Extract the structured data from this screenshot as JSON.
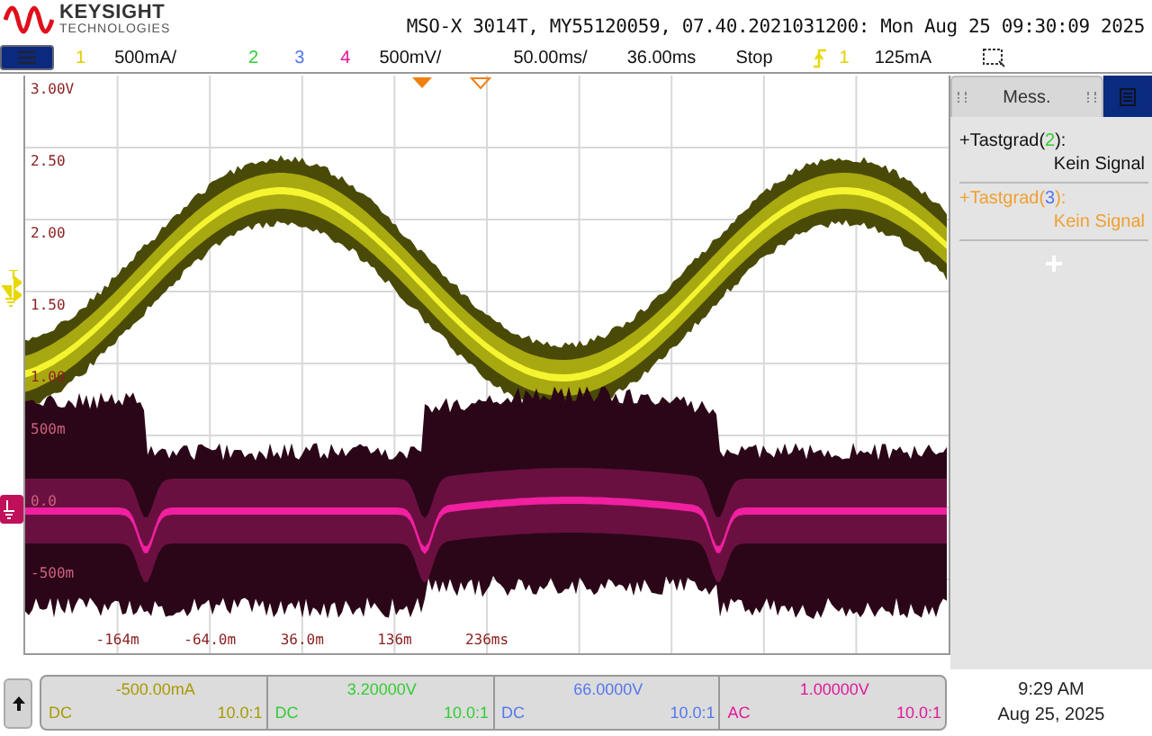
{
  "header": {
    "logo": {
      "name": "KEYSIGHT",
      "sub": "TECHNOLOGIES"
    },
    "title": "MSO-X 3014T, MY55120059, 07.40.2021031200: Mon Aug 25 09:30:09 2025"
  },
  "channel_bar": {
    "channels": [
      {
        "number": "1",
        "color": "#e0d000",
        "scale": "500mA/"
      },
      {
        "number": "2",
        "color": "#33cc33"
      },
      {
        "number": "3",
        "color": "#5577ee"
      },
      {
        "number": "4",
        "color": "#e0189a",
        "scale": "500mV/"
      }
    ],
    "timebase": "50.00ms/",
    "delay": "36.00ms",
    "run_state": "Stop",
    "trigger": {
      "source": "1",
      "level": "125mA"
    }
  },
  "plot": {
    "y_labels_ch1": [
      "3.00V",
      "2.50",
      "2.00",
      "1.50",
      "1.00"
    ],
    "y_labels_ch4": [
      "500m",
      "0.0",
      "-500m"
    ],
    "x_labels": [
      "-164m",
      "-64.0m",
      "36.0m",
      "136m",
      "236ms"
    ]
  },
  "measurements": {
    "tab": "Mess.",
    "items": [
      {
        "label": "+Tastgrad(",
        "channel": "2",
        "end": "):",
        "value": "Kein Signal",
        "selected": false
      },
      {
        "label": "+Tastgrad(",
        "channel": "3",
        "end": "):",
        "value": "Kein Signal",
        "selected": true
      }
    ]
  },
  "channel_info": [
    {
      "value": "-500.00mA",
      "coupling": "DC",
      "probe": "10.0:1",
      "color": "#a89a00"
    },
    {
      "value": "3.20000V",
      "coupling": "DC",
      "probe": "10.0:1",
      "color": "#33cc33"
    },
    {
      "value": "66.0000V",
      "coupling": "DC",
      "probe": "10.0:1",
      "color": "#5577ee"
    },
    {
      "value": "1.00000V",
      "coupling": "AC",
      "probe": "10.0:1",
      "color": "#e0189a"
    }
  ],
  "clock": {
    "time": "9:29 AM",
    "date": "Aug 25, 2025"
  }
}
